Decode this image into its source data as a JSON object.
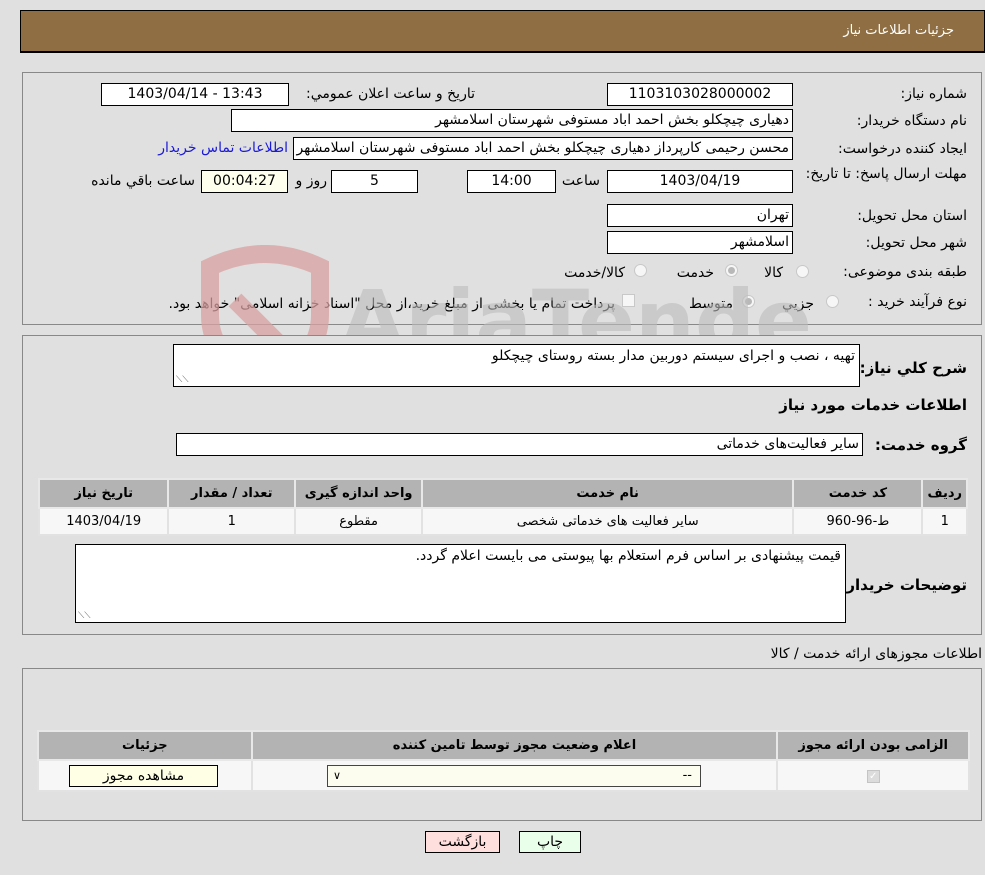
{
  "header": {
    "title": "جزئیات اطلاعات نیاز"
  },
  "info": {
    "need_number_label": "شماره نیاز:",
    "need_number": "1103103028000002",
    "announce_label": "تاریخ و ساعت اعلان عمومي:",
    "announce_value": "1403/04/14 - 13:43",
    "buyer_org_label": "نام دستگاه خريدار:",
    "buyer_org": "دهیاری چیچکلو بخش احمد اباد مستوفی شهرستان اسلامشهر",
    "creator_label": "ايجاد کننده درخواست:",
    "creator": "محسن رحیمی کارپرداز دهیاری چیچکلو بخش احمد اباد مستوفی شهرستان اسلامشهر",
    "contact_link": "اطلاعات تماس خريدار",
    "deadline_label": "مهلت ارسال پاسخ: تا تاریخ:",
    "deadline_date": "1403/04/19",
    "time_label": "ساعت",
    "deadline_time": "14:00",
    "days": "5",
    "days_label": "روز و",
    "remaining": "00:04:27",
    "remaining_label": "ساعت باقي مانده",
    "province_label": "استان محل تحويل:",
    "province": "تهران",
    "city_label": "شهر محل تحويل:",
    "city": "اسلامشهر",
    "category_label": "طبقه بندی موضوعی:",
    "category_options": [
      {
        "label": "کالا",
        "checked": false
      },
      {
        "label": "خدمت",
        "checked": true
      },
      {
        "label": "کالا/خدمت",
        "checked": false
      }
    ],
    "process_label": "نوع فرآيند خريد :",
    "process_options": [
      {
        "label": "جزيي",
        "checked": false
      },
      {
        "label": "متوسط",
        "checked": true
      }
    ],
    "treasury_checkbox_label": "پرداخت تمام يا بخشی از مبلغ خريد،از محل \"اسناد خزانه اسلامی\" خواهد بود.",
    "treasury_checked": false
  },
  "description": {
    "label": "شرح کلي نياز:",
    "value": "تهیه ، نصب و اجرای سیستم دوربین مدار بسته روستای چیچکلو"
  },
  "services": {
    "section_title": "اطلاعات خدمات مورد نياز",
    "group_label": "گروه خدمت:",
    "group_value": "سایر فعالیت‌های خدماتی",
    "columns": [
      "رديف",
      "کد خدمت",
      "نام خدمت",
      "واحد اندازه گيری",
      "تعداد / مقدار",
      "تاريخ نياز"
    ],
    "rows": [
      [
        "1",
        "ط-96-960",
        "سایر فعالیت های خدماتی شخصی",
        "مقطوع",
        "1",
        "1403/04/19"
      ]
    ]
  },
  "buyer_notes": {
    "label": "توضيحات خريدار:",
    "value": "قیمت پیشنهادی بر اساس فرم استعلام بها پیوستی می بایست اعلام گردد."
  },
  "permits": {
    "section_title": "اطلاعات مجوزهای ارائه خدمت / کالا",
    "columns": [
      "الزامی بودن ارائه مجوز",
      "اعلام وضعيت مجوز توسط تامين کننده",
      "جزئيات"
    ],
    "rows": [
      {
        "required_checked": true,
        "status_selected": "--",
        "details_button": "مشاهده مجوز"
      }
    ]
  },
  "actions": {
    "print": "چاپ",
    "back": "بازگشت"
  },
  "watermark": {
    "text": "AriaTender.neT"
  }
}
